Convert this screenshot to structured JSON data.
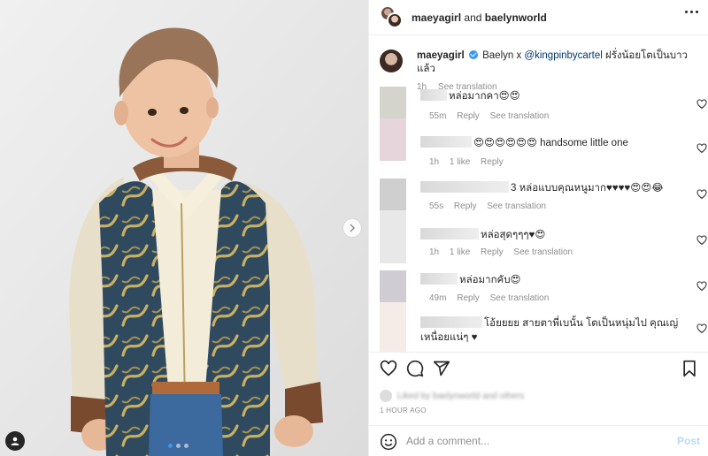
{
  "post": {
    "owner": "maeyagirl",
    "collaborator": "baelynworld",
    "header_joiner": "and",
    "caption_text": "Baelyn x",
    "caption_mention": "@kingpinbycartel",
    "caption_thai": "ฝรั่งน้อยโตเป็นบาวแล้ว",
    "caption_time": "1h",
    "see_translation": "See translation",
    "carousel_dots": 3,
    "active_dot": 0
  },
  "comments": [
    {
      "text": "หล่อมากคา😍😍",
      "time": "55m",
      "likes": "",
      "reply": "Reply",
      "translate": "See translation"
    },
    {
      "text": "😍😍😍😍😍😍 handsome little one",
      "time": "1h",
      "likes": "1 like",
      "reply": "Reply",
      "translate": ""
    },
    {
      "text": "3 หล่อแบบคุณหนูมาก♥♥♥♥😍😍😂",
      "time": "55s",
      "likes": "",
      "reply": "Reply",
      "translate": "See translation"
    },
    {
      "text": "หล่อสุดๆๆๆ♥😍",
      "time": "1h",
      "likes": "1 like",
      "reply": "Reply",
      "translate": "See translation"
    },
    {
      "text": "หล่อมากคับ😍",
      "time": "49m",
      "likes": "",
      "reply": "Reply",
      "translate": "See translation"
    },
    {
      "text": "โอ้ยยยย สายตาพี่เบนั้น โตเป็นหนุ่มไป คุณเญ่เหนื่อยแน่ๆ ♥",
      "time": "",
      "likes": "",
      "reply": "",
      "translate": ""
    }
  ],
  "actions": {
    "liked_by": "Liked by baelynworld and others",
    "time_ago": "1 HOUR AGO"
  },
  "composer": {
    "placeholder": "Add a comment...",
    "post_label": "Post"
  },
  "colors": {
    "accent": "#3897f0",
    "heart": "#ed1c24",
    "post_disabled": "#b3dbff",
    "jacket": "#2f4a5f",
    "jacket_pattern": "#c9b062"
  },
  "icons": [
    "heart-icon",
    "comment-icon",
    "share-icon",
    "bookmark-icon",
    "emoji-icon",
    "more-icon",
    "chevron-right-icon",
    "user-tag-icon"
  ]
}
